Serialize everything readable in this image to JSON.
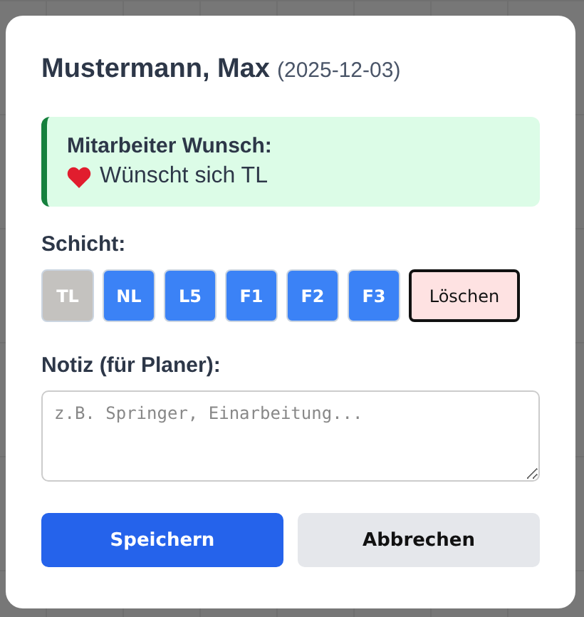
{
  "dialog": {
    "name": "Mustermann, Max",
    "date": "(2025-12-03)"
  },
  "wish": {
    "title": "Mitarbeiter Wunsch:",
    "text": "Wünscht sich TL"
  },
  "shift": {
    "label": "Schicht:",
    "options": [
      {
        "kind": "shift",
        "label": "TL",
        "disabled": true
      },
      {
        "kind": "shift",
        "label": "NL",
        "disabled": false
      },
      {
        "kind": "shift",
        "label": "L5",
        "disabled": false
      },
      {
        "kind": "shift",
        "label": "F1",
        "disabled": false
      },
      {
        "kind": "shift",
        "label": "F2",
        "disabled": false
      },
      {
        "kind": "shift",
        "label": "F3",
        "disabled": false
      },
      {
        "kind": "delete",
        "label": "Löschen",
        "disabled": false
      }
    ]
  },
  "note": {
    "label": "Notiz (für Planer):",
    "placeholder": "z.B. Springer, Einarbeitung..."
  },
  "buttons": [
    {
      "kind": "primary",
      "label": "Speichern"
    },
    {
      "kind": "secondary",
      "label": "Abbrechen"
    }
  ]
}
